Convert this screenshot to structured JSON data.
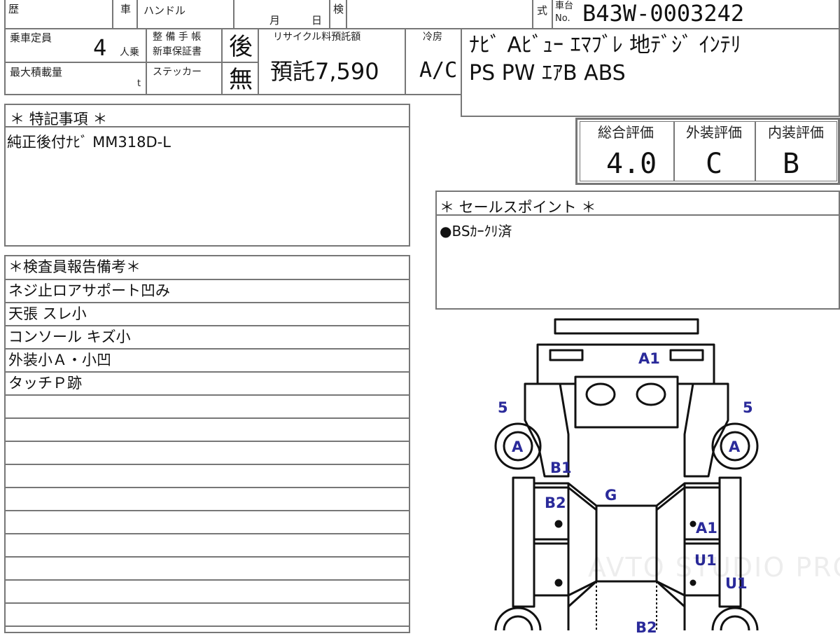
{
  "top_row": {
    "history_label": "歴",
    "vehicle_label": "車",
    "handle_label": "ハンドル",
    "month_label": "月",
    "day_label": "日",
    "inspection_label": "検",
    "model_label": "式",
    "chassis_label_1": "車台",
    "chassis_label_2": "No.",
    "chassis_no": "B43W-0003242"
  },
  "capacity": {
    "label": "乗車定員",
    "value": "4",
    "unit": "人乗"
  },
  "max_load": {
    "label": "最大積載量",
    "unit": "t"
  },
  "manual": {
    "label_1": "整 備 手 帳",
    "label_2": "新車保証書",
    "value": "後"
  },
  "sticker": {
    "label": "ステッカー",
    "value": "無"
  },
  "recycle": {
    "label": "リサイクル料預託額",
    "value": "預託7,590"
  },
  "aircon": {
    "label": "冷房",
    "value": "A/C"
  },
  "equipment": {
    "line1": "ﾅﾋﾞ Aﾋﾞｭｰ ｴﾏﾌﾞﾚ 地ﾃﾞｼﾞ ｲﾝﾃﾘ",
    "line2": "PS PW ｴｱB ABS"
  },
  "special_notes": {
    "title": "＊ 特記事項 ＊",
    "text": "純正後付ﾅﾋﾞ MM318D-L"
  },
  "grades": {
    "overall_label": "総合評価",
    "exterior_label": "外装評価",
    "interior_label": "内装評価",
    "overall": "4.0",
    "exterior": "C",
    "interior": "B"
  },
  "sales_points": {
    "title": "＊ セールスポイント ＊",
    "text": "●BSｶｰｸﾘ済"
  },
  "inspector_report": {
    "title": "＊検査員報告備考＊",
    "lines": [
      "ネジ止ロアサポート凹み",
      "天張 スレ小",
      "コンソール キズ小",
      "外装小Ａ・小凹",
      "タッチＰ跡",
      "",
      "",
      "",
      "",
      "",
      "",
      "",
      "",
      "",
      ""
    ]
  },
  "diagram_marks": {
    "front_bumper": "A1",
    "left_fender_num": "5",
    "right_fender_num": "5",
    "left_wheel": "A",
    "right_wheel": "A",
    "left_front_pillar": "B1",
    "left_door_front": "B2",
    "windshield": "G",
    "right_door_front": "A1",
    "right_door_front_2": "U1",
    "right_door_rear": "U1",
    "rear_center": "B2"
  },
  "watermark": "AVTO STUDIO PRO"
}
